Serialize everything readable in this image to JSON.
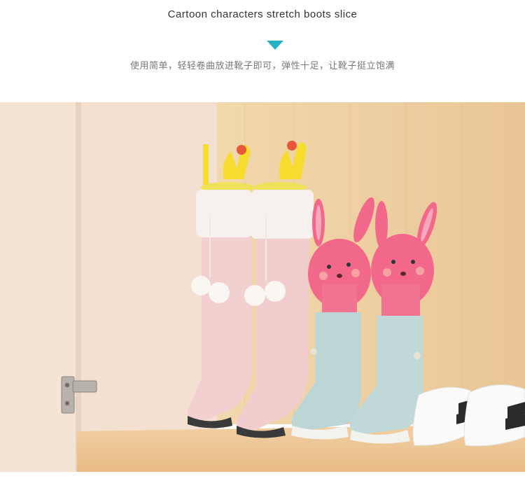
{
  "header": {
    "title": "Cartoon characters stretch boots slice",
    "subtitle": "使用简单，轻轻卷曲放进靴子即可，弹性十足，让靴子挺立饱满"
  },
  "photo": {
    "description_icon": "product-photo",
    "colors": {
      "accent_arrow": "#23b3c4",
      "wood_wall": "#eed2a4",
      "cabinet": "#f3dfcd",
      "shelf": "#efc89a",
      "pink_boot": "#f2cfcf",
      "blue_boot": "#bcd5d6",
      "rabbit": "#f2688a",
      "deer_shaper": "#f5dc2e"
    }
  }
}
